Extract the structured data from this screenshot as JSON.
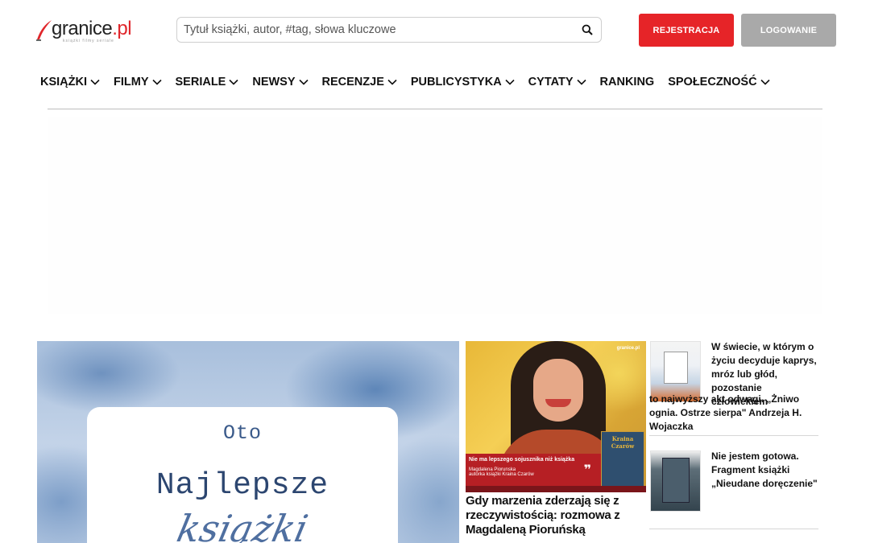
{
  "brand": {
    "logo_text": "granice",
    "logo_suffix": ".pl",
    "tagline": "książki filmy seriale",
    "accent_color": "#e62428"
  },
  "search": {
    "placeholder": "Tytuł książki, autor, #tag, słowa kluczowe",
    "value": "",
    "icon": "search-icon"
  },
  "auth": {
    "register_label": "REJESTRACJA",
    "login_label": "LOGOWANIE"
  },
  "nav": {
    "items": [
      {
        "label": "KSIĄŻKI",
        "has_dropdown": true
      },
      {
        "label": "FILMY",
        "has_dropdown": true
      },
      {
        "label": "SERIALE",
        "has_dropdown": true
      },
      {
        "label": "NEWSY",
        "has_dropdown": true
      },
      {
        "label": "RECENZJE",
        "has_dropdown": true
      },
      {
        "label": "PUBLICYSTYKA",
        "has_dropdown": true
      },
      {
        "label": "CYTATY",
        "has_dropdown": true
      },
      {
        "label": "RANKING",
        "has_dropdown": false
      },
      {
        "label": "SPOŁECZNOŚĆ",
        "has_dropdown": true
      }
    ]
  },
  "feature": {
    "line1": "Oto",
    "line2": "Najlepsze",
    "line3": "książki"
  },
  "center_article": {
    "promo_title": "Nie ma lepszego sojusznika niż książka",
    "promo_author": "Magdalena Piorunska",
    "promo_subtitle": "autorka książki Kraina Czarów",
    "cover_title": "Kraina Czarów",
    "brand_mark": "granice.pl",
    "headline": "Gdy marzenia zderzają się z rzeczywistością: rozmowa z Magdaleną Pioruńską"
  },
  "side_articles": [
    {
      "title_top": "W świecie, w którym o życiu decyduje kaprys, mróz lub głód, pozostanie człowiekiem",
      "title_bottom": "to najwyższy akt odwagi. „Żniwo ognia. Ostrze sierpa\" Andrzeja H. Wojaczka"
    },
    {
      "title_top": "Nie jestem gotowa. Fragment książki „Nieudane doręczenie\""
    }
  ]
}
